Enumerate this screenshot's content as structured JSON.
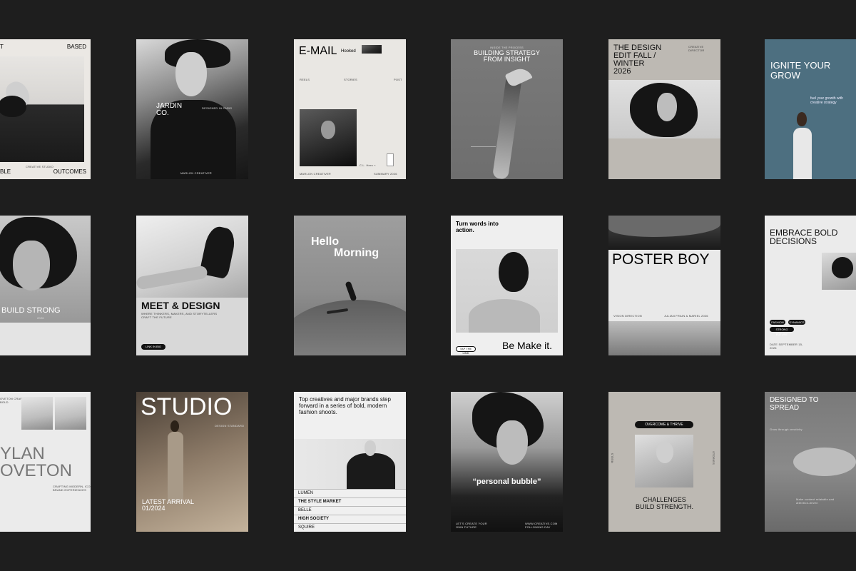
{
  "cards": {
    "c1": {
      "top_left": "T",
      "top_right": "BASED",
      "bottom_left": "BLE",
      "bottom_right": "OUTCOMES",
      "caption": "CREATIVE STUDIO"
    },
    "c2": {
      "title": "JARDIN\nCO.",
      "subtitle": "DESIGNED IN PARIS",
      "footer": "MARLON CREATIVE®"
    },
    "c3": {
      "title": "E-MAIL",
      "hooked": "Hooked",
      "tab1": "REELS",
      "tab2": "STORIES",
      "tab3": "POST",
      "footer_left": "MARLON CREATIVE®",
      "footer_right": "SUMMARY 2026",
      "caption": "C.L. Hern ⌁"
    },
    "c4": {
      "title": "BUILDING STRATEGY\nFROM INSIGHT",
      "kicker": "INSIDE THE PROCESS"
    },
    "c5": {
      "title": "THE DESIGN\nEDIT FALL /\nWINTER\n2026",
      "label": "CREATIVE DIRECTOR"
    },
    "c6": {
      "title": "IGNITE YOUR\nGROW",
      "subtitle": "fuel your growth with\ncreative strategy"
    },
    "c7": {
      "title": "BUILD STRONG",
      "year": "2026"
    },
    "c8": {
      "title": "MEET & DESIGN",
      "subtitle": "WHERE THINKERS, MAKERS, AND STORYTELLERS\nCRAFT THE FUTURE",
      "button": "LINK IN BIO"
    },
    "c9": {
      "title1": "Hello",
      "title2": "Morning"
    },
    "c10": {
      "title": "Turn words into\naction.",
      "bottom": "Be Make it.",
      "button": "TAP THE LINK"
    },
    "c11": {
      "title": "POSTER BOY",
      "left_label": "VISION DIRECTION",
      "right_label": "JULIAN FRAIN & MARIEL 2026"
    },
    "c12": {
      "title": "EMBRACE BOLD\nDECISIONS",
      "tag1": "FASHION",
      "tag2": "DYNAMICS",
      "tag3": "STRONG FUTURE",
      "date": "DATE SEPTEMBER 15,\n2026"
    },
    "c13": {
      "title": "YLAN\nOVETON",
      "kicker": "OVETON CRAFTS\nBOLD",
      "caption": "CRAFTING MODERN, ICONIC\nBRAND EXPERIENCES"
    },
    "c14": {
      "title": "STUDIO",
      "subtitle": "DESIGN STANDARD",
      "latest": "LATEST ARRIVAL\n01/2024"
    },
    "c15": {
      "title": "Top creatives and major brands step forward in a series of bold, modern fashion shoots.",
      "list": [
        "LUMEN",
        "THE STYLE MARKET",
        "BELLE",
        "HIGH SOCIETY",
        "SQUIRE"
      ]
    },
    "c16": {
      "quote": "“personal bubble”",
      "footer_left": "LET'S CREATE YOUR\nOWN FUTURE",
      "footer_right": "WWW.CREATIVE.COM\nFOLLOWING DAY"
    },
    "c17": {
      "pill": "OVERCOME & THRIVE",
      "side_left": "REELS",
      "side_right": "STORIES",
      "title": "CHALLENGES\nBUILD STRENGTH."
    },
    "c18": {
      "title": "DESIGNED TO\nSPREAD",
      "subtitle": "Grow through creativity",
      "footer": "Make content relatable and\nattention-driven"
    }
  },
  "colors": {
    "background": "#1e1e1e",
    "paper": "#e9e7e3",
    "stone": "#bdb9b3",
    "teal": "#4d6f80",
    "dark": "#111111"
  }
}
